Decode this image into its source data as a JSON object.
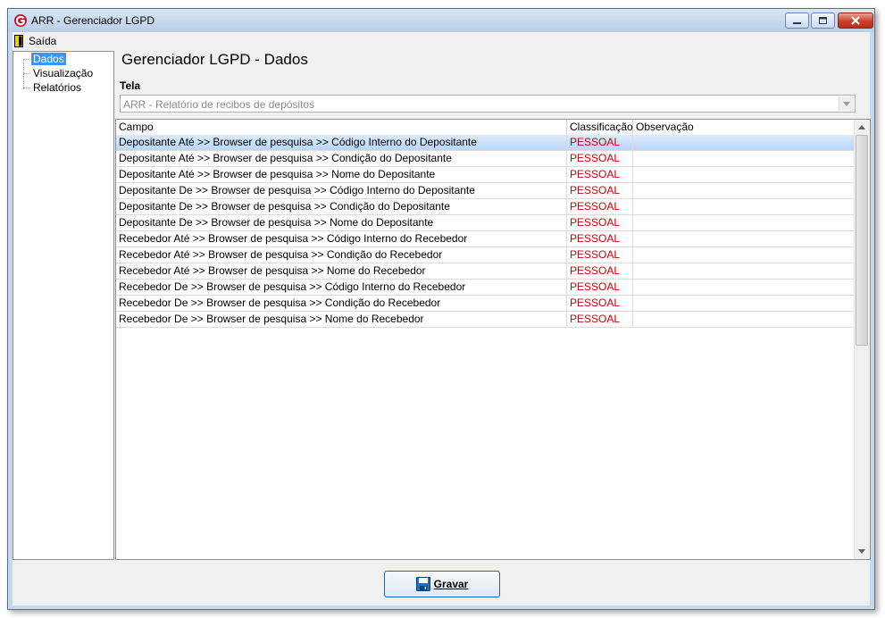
{
  "window": {
    "title": "ARR - Gerenciador LGPD"
  },
  "menu": {
    "exit_label": "Saída"
  },
  "tree": {
    "items": [
      "Dados",
      "Visualização",
      "Relatórios"
    ],
    "selected": "Dados"
  },
  "page": {
    "title": "Gerenciador LGPD - Dados"
  },
  "tela": {
    "label": "Tela",
    "value": "ARR - Relatório de recibos de depósitos"
  },
  "grid": {
    "columns": [
      "Campo",
      "Classificação",
      "Observação"
    ],
    "rows": [
      {
        "campo": "Depositante Até >> Browser de pesquisa >> Código Interno do Depositante",
        "classificacao": "PESSOAL",
        "observacao": ""
      },
      {
        "campo": "Depositante Até >> Browser de pesquisa >> Condição do Depositante",
        "classificacao": "PESSOAL",
        "observacao": ""
      },
      {
        "campo": "Depositante Até >> Browser de pesquisa >> Nome do Depositante",
        "classificacao": "PESSOAL",
        "observacao": ""
      },
      {
        "campo": "Depositante De >> Browser de pesquisa >> Código Interno do Depositante",
        "classificacao": "PESSOAL",
        "observacao": ""
      },
      {
        "campo": "Depositante De >> Browser de pesquisa >> Condição do Depositante",
        "classificacao": "PESSOAL",
        "observacao": ""
      },
      {
        "campo": "Depositante De >> Browser de pesquisa >> Nome do Depositante",
        "classificacao": "PESSOAL",
        "observacao": ""
      },
      {
        "campo": "Recebedor Até >> Browser de pesquisa >> Código Interno do Recebedor",
        "classificacao": "PESSOAL",
        "observacao": ""
      },
      {
        "campo": "Recebedor Até >> Browser de pesquisa >> Condição do Recebedor",
        "classificacao": "PESSOAL",
        "observacao": ""
      },
      {
        "campo": "Recebedor Até >> Browser de pesquisa >> Nome do Recebedor",
        "classificacao": "PESSOAL",
        "observacao": ""
      },
      {
        "campo": "Recebedor De >> Browser de pesquisa >> Código Interno do Recebedor",
        "classificacao": "PESSOAL",
        "observacao": ""
      },
      {
        "campo": "Recebedor De >> Browser de pesquisa >> Condição do Recebedor",
        "classificacao": "PESSOAL",
        "observacao": ""
      },
      {
        "campo": "Recebedor De >> Browser de pesquisa >> Nome do Recebedor",
        "classificacao": "PESSOAL",
        "observacao": ""
      }
    ],
    "selected_row": 0
  },
  "actions": {
    "save_label": "Gravar"
  },
  "colors": {
    "classification_text": "#d00000",
    "tree_selection": "#3399ff",
    "row_selection": "#c7ddf8"
  },
  "icons": {
    "app": "arr-logo-icon",
    "exit": "door-exit-icon",
    "save": "floppy-disk-icon"
  }
}
